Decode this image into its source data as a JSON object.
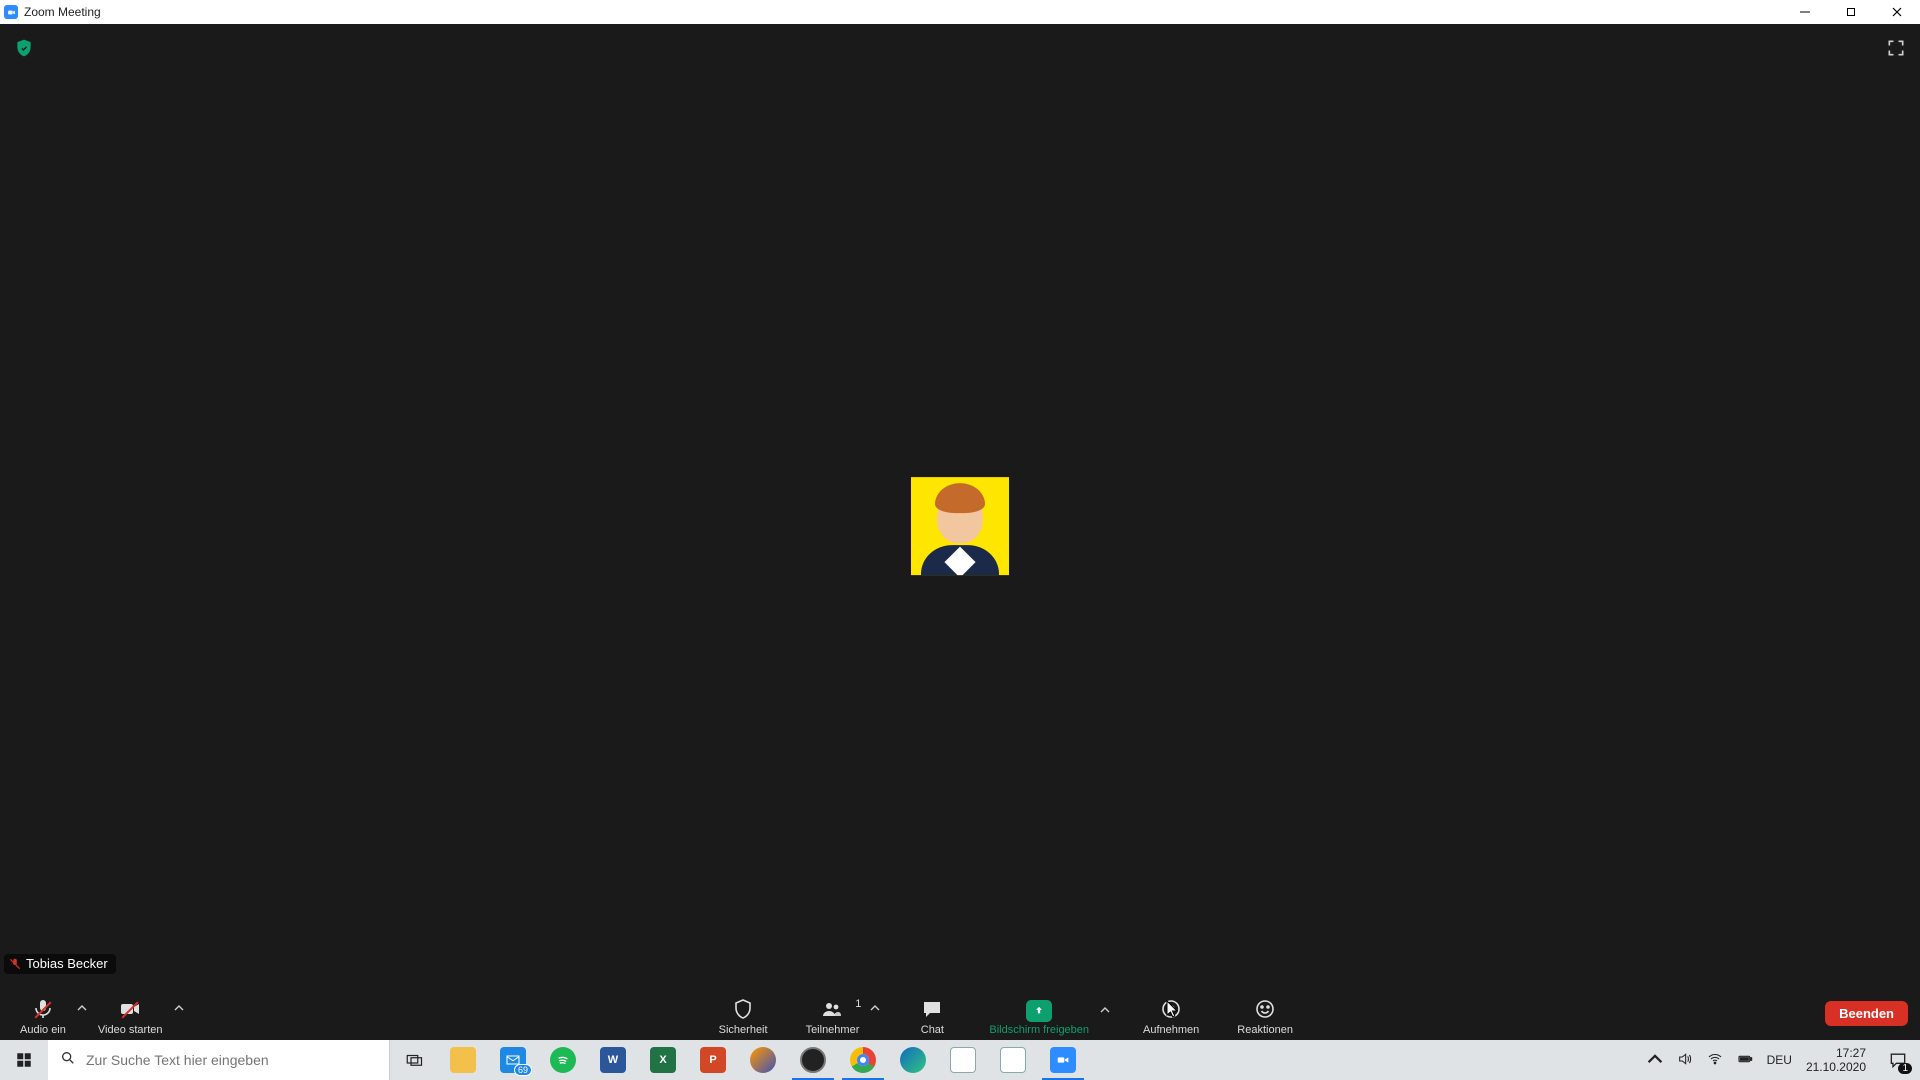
{
  "window": {
    "title": "Zoom Meeting"
  },
  "meeting": {
    "participant_name": "Tobias Becker",
    "toolbar": {
      "audio": "Audio ein",
      "video": "Video starten",
      "security": "Sicherheit",
      "participants": "Teilnehmer",
      "participants_count": "1",
      "chat": "Chat",
      "share": "Bildschirm freigeben",
      "record": "Aufnehmen",
      "reactions": "Reaktionen",
      "end": "Beenden"
    }
  },
  "taskbar": {
    "search_placeholder": "Zur Suche Text hier eingeben",
    "mail_badge": "69",
    "language": "DEU",
    "time": "17:27",
    "date": "21.10.2020",
    "notification_count": "1"
  }
}
